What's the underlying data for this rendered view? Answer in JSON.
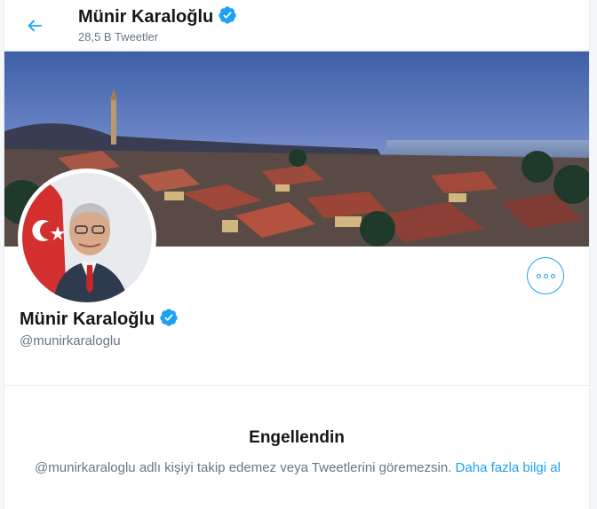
{
  "header": {
    "name": "Münir Karaloğlu",
    "tweet_count": "28,5 B Tweetler"
  },
  "profile": {
    "name": "Münir Karaloğlu",
    "handle": "@munirkaraloglu"
  },
  "blocked": {
    "title": "Engellendin",
    "message": "@munirkaraloglu adlı kişiyi takip edemez veya Tweetlerini göremezsin.",
    "link": "Daha fazla bilgi al"
  },
  "colors": {
    "accent": "#1da1f2",
    "secondary_text": "#657786"
  },
  "icons": [
    "back-arrow-icon",
    "verified-badge-icon",
    "more-options-icon"
  ]
}
